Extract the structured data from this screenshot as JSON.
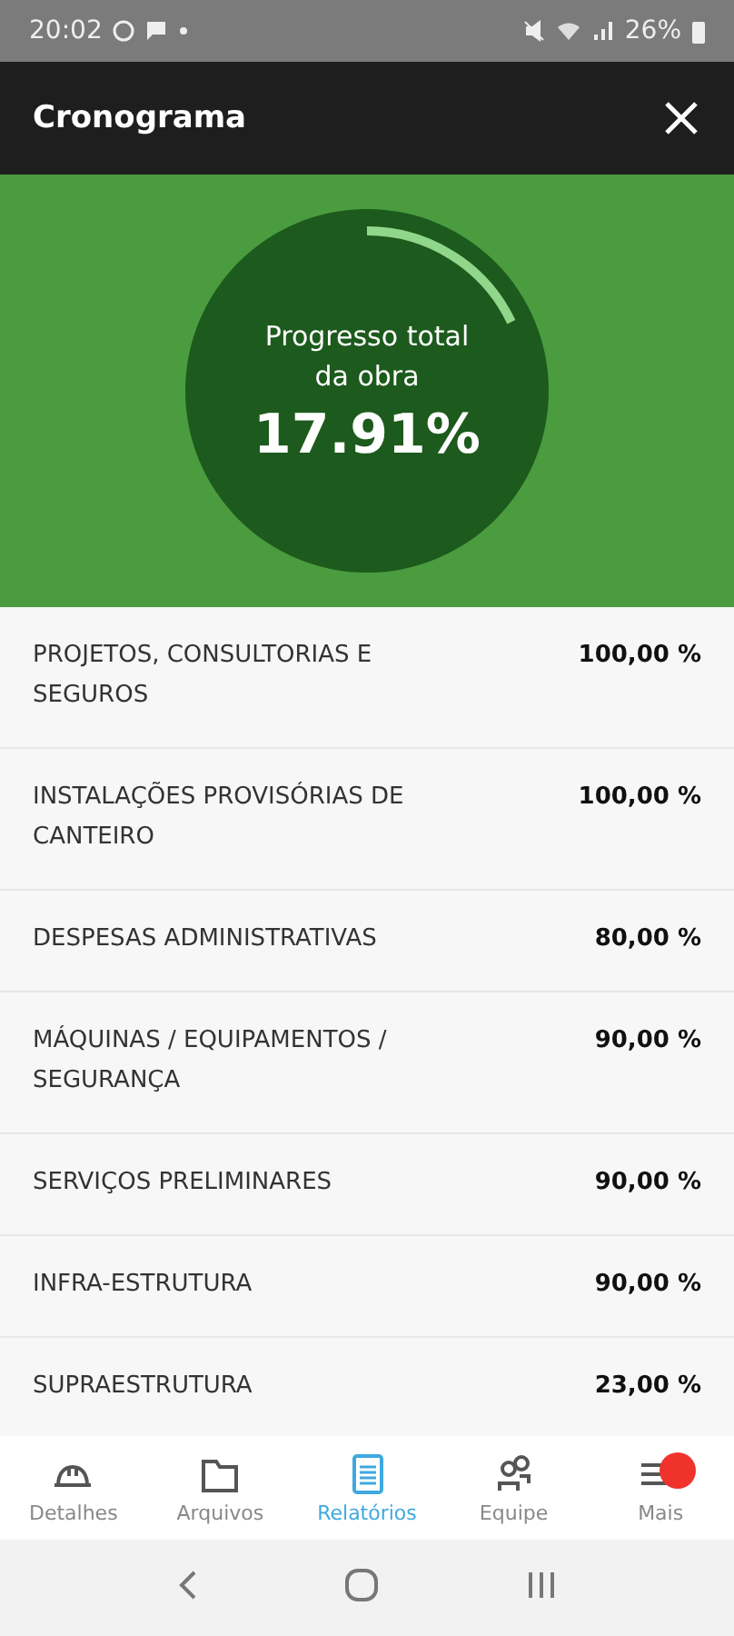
{
  "status_bar": {
    "time": "20:02",
    "battery": "26%"
  },
  "header": {
    "title": "Cronograma"
  },
  "progress": {
    "label": "Progresso total da obra",
    "value": "17.91%",
    "level": 0.1791
  },
  "items": [
    {
      "name": "PROJETOS, CONSULTORIAS E SEGUROS",
      "percent": "100,00 %"
    },
    {
      "name": "INSTALAÇÕES PROVISÓRIAS DE CANTEIRO",
      "percent": "100,00 %"
    },
    {
      "name": "DESPESAS ADMINISTRATIVAS",
      "percent": "80,00 %"
    },
    {
      "name": "MÁQUINAS / EQUIPAMENTOS / SEGURANÇA",
      "percent": "90,00 %"
    },
    {
      "name": "SERVIÇOS PRELIMINARES",
      "percent": "90,00 %"
    },
    {
      "name": "INFRA-ESTRUTURA",
      "percent": "90,00 %"
    },
    {
      "name": "SUPRAESTRUTURA",
      "percent": "23,00 %"
    }
  ],
  "nav": [
    {
      "kind": "helmet",
      "label": "Detalhes",
      "selected": false,
      "badge": false
    },
    {
      "kind": "folder",
      "label": "Arquivos",
      "selected": false,
      "badge": false
    },
    {
      "kind": "report",
      "label": "Relatórios",
      "selected": true,
      "badge": false
    },
    {
      "kind": "team",
      "label": "Equipe",
      "selected": false,
      "badge": false
    },
    {
      "kind": "menu",
      "label": "Mais",
      "selected": false,
      "badge": true
    }
  ]
}
